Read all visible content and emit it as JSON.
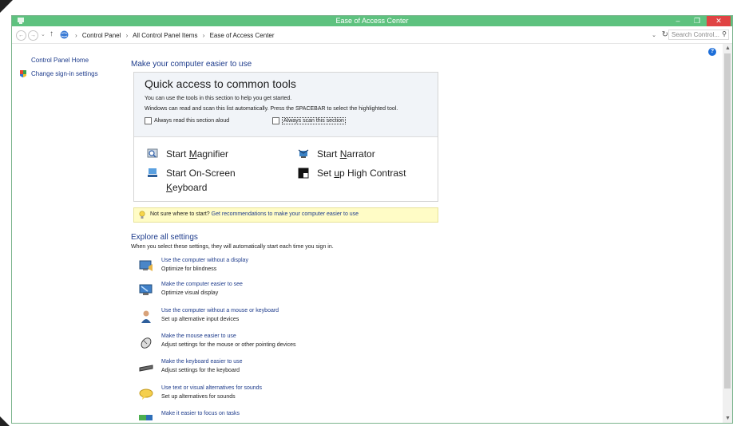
{
  "window": {
    "title": "Ease of Access Center",
    "minimize_glyph": "–",
    "maximize_glyph": "❐",
    "close_glyph": "✕"
  },
  "address": {
    "back_glyph": "←",
    "forward_glyph": "→",
    "dropdown_glyph": "⌄",
    "up_glyph": "↑",
    "separator": "›",
    "breadcrumbs": [
      "Control Panel",
      "All Control Panel Items",
      "Ease of Access Center"
    ],
    "refresh_glyph": "↻",
    "search_placeholder": "Search Control...",
    "search_glyph": "⚲"
  },
  "sidebar": {
    "home_label": "Control Panel Home",
    "signin_label": "Change sign-in settings"
  },
  "main": {
    "heading": "Make your computer easier to use",
    "quick_access": {
      "title": "Quick access to common tools",
      "desc1": "You can use the tools in this section to help you get started.",
      "desc2": "Windows can read and scan this list automatically.  Press the SPACEBAR to select the highlighted tool.",
      "always_read_label": "Always read this section aloud",
      "always_scan_label": "Always scan this section"
    },
    "tools": {
      "magnifier_pre": "Start ",
      "magnifier_u": "M",
      "magnifier_post": "agnifier",
      "narrator_pre": "Start ",
      "narrator_u": "N",
      "narrator_post": "arrator",
      "osk_pre": "Start On-Screen ",
      "osk_u": "K",
      "osk_post": "eyboard",
      "contrast_pre": "Set ",
      "contrast_u": "u",
      "contrast_post": "p High Contrast"
    },
    "hint": {
      "text": "Not sure where to start? ",
      "link": "Get recommendations to make your computer easier to use"
    },
    "explore": {
      "heading": "Explore all settings",
      "desc": "When you select these settings, they will automatically start each time you sign in."
    },
    "settings": [
      {
        "link": "Use the computer without a display",
        "desc": "Optimize for blindness"
      },
      {
        "link": "Make the computer easier to see",
        "desc": "Optimize visual display"
      },
      {
        "link": "Use the computer without a mouse or keyboard",
        "desc": "Set up alternative input devices"
      },
      {
        "link": "Make the mouse easier to use",
        "desc": "Adjust settings for the mouse or other pointing devices"
      },
      {
        "link": "Make the keyboard easier to use",
        "desc": "Adjust settings for the keyboard"
      },
      {
        "link": "Use text or visual alternatives for sounds",
        "desc": "Set up alternatives for sounds"
      },
      {
        "link": "Make it easier to focus on tasks",
        "desc": ""
      }
    ]
  },
  "help_glyph": "?",
  "scroll_up_glyph": "▲",
  "scroll_down_glyph": "▼"
}
